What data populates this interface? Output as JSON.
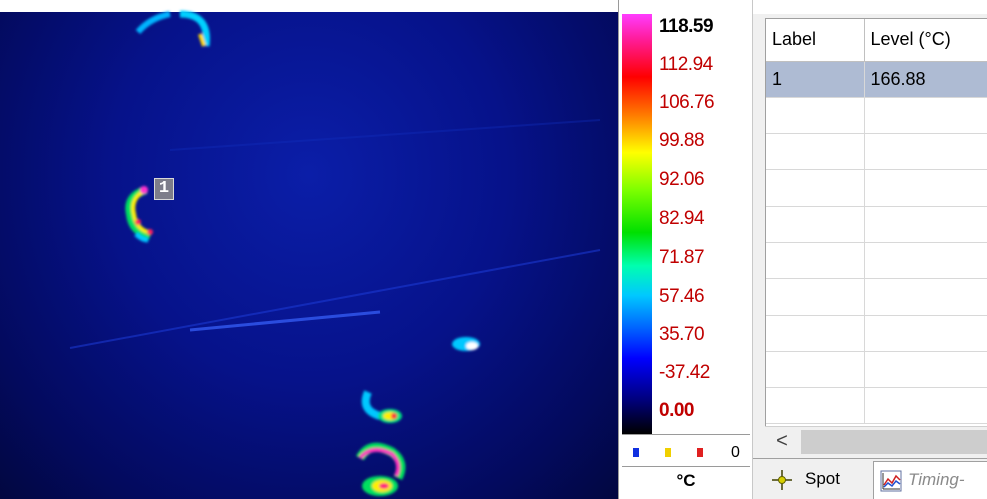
{
  "thermal_view": {
    "spot_label": "1"
  },
  "color_scale": {
    "labels": [
      "118.59",
      "112.94",
      "106.76",
      "99.88",
      "92.06",
      "82.94",
      "71.87",
      "57.46",
      "35.70",
      "-37.42",
      "0.00"
    ],
    "palette_count": "0",
    "palette_colors": [
      "#1030e0",
      "#f0d000",
      "#e02020"
    ],
    "unit": "°C"
  },
  "spot_table": {
    "headers": [
      "Label",
      "Level (°C)"
    ],
    "rows": [
      {
        "label": "1",
        "level": "166.88"
      }
    ],
    "scroll_left_glyph": "<"
  },
  "tabs": [
    {
      "label": "Spot",
      "icon": "spot-crosshair-icon",
      "active": true
    },
    {
      "label": "Timing-",
      "icon": "timing-chart-icon",
      "active": false
    }
  ]
}
